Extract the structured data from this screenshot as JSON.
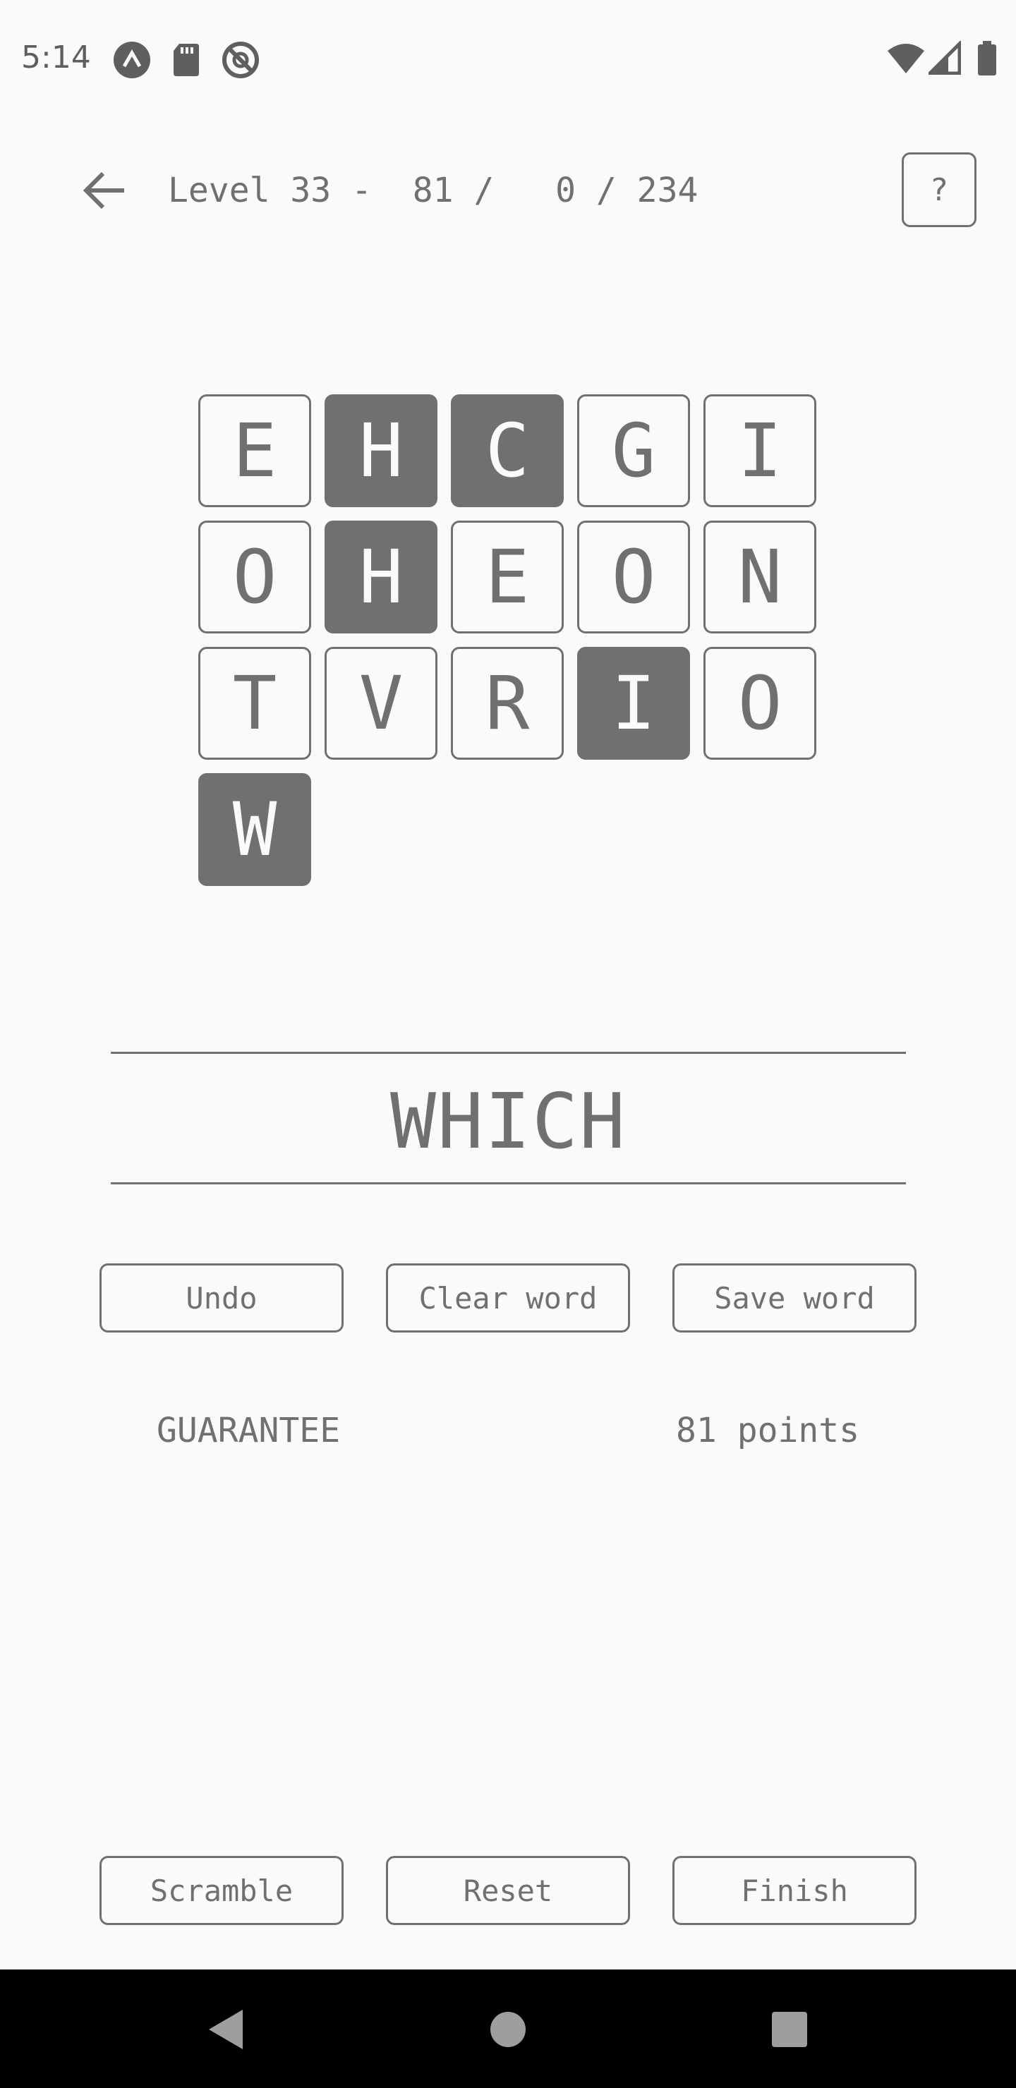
{
  "status_bar": {
    "time": "5:14",
    "icons": [
      "app-a-icon",
      "sd-card-icon",
      "blocked-icon",
      "wifi-icon",
      "cell-signal-icon",
      "battery-icon"
    ]
  },
  "header": {
    "back_icon": "arrow-left-icon",
    "level_text": "Level 33 -  81 /   0 / 234",
    "help_label": "?"
  },
  "grid": {
    "rows": [
      [
        {
          "letter": "E",
          "selected": false
        },
        {
          "letter": "H",
          "selected": true
        },
        {
          "letter": "C",
          "selected": true
        },
        {
          "letter": "G",
          "selected": false
        },
        {
          "letter": "I",
          "selected": false
        }
      ],
      [
        {
          "letter": "O",
          "selected": false
        },
        {
          "letter": "H",
          "selected": true
        },
        {
          "letter": "E",
          "selected": false
        },
        {
          "letter": "O",
          "selected": false
        },
        {
          "letter": "N",
          "selected": false
        }
      ],
      [
        {
          "letter": "T",
          "selected": false
        },
        {
          "letter": "V",
          "selected": false
        },
        {
          "letter": "R",
          "selected": false
        },
        {
          "letter": "I",
          "selected": true
        },
        {
          "letter": "O",
          "selected": false
        }
      ],
      [
        {
          "letter": "W",
          "selected": true
        }
      ]
    ]
  },
  "current_word": "WHICH",
  "actions": {
    "undo": "Undo",
    "clear_word": "Clear word",
    "save_word": "Save word"
  },
  "saved": {
    "word": "GUARANTEE",
    "points": "81 points"
  },
  "bottom_actions": {
    "scramble": "Scramble",
    "reset": "Reset",
    "finish": "Finish"
  },
  "colors": {
    "background": "#fafafa",
    "foreground": "#707070",
    "nav_bar": "#000000"
  }
}
